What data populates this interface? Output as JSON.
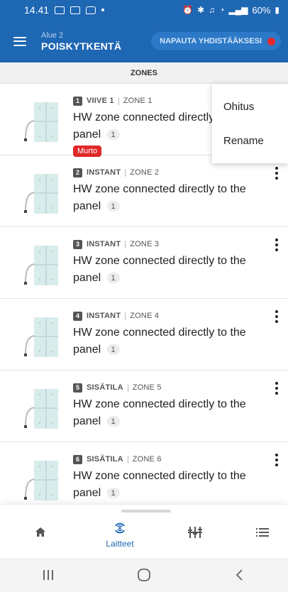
{
  "status_bar": {
    "time": "14.41",
    "battery": "60%"
  },
  "app_bar": {
    "subtitle": "Alue 2",
    "title": "POISKYTKENTÄ",
    "connect_label": "NAPAUTA YHDISTÄÄKSESI"
  },
  "section": {
    "header": "ZONES"
  },
  "popup_menu": {
    "items": [
      {
        "label": "Ohitus"
      },
      {
        "label": "Rename"
      }
    ]
  },
  "zones": [
    {
      "number": "1",
      "type": "VIIVE 1",
      "zone": "ZONE 1",
      "name": "HW zone connected directly to the panel",
      "name_shown": "HW zone connected directly",
      "name_line2": "panel",
      "count": "1",
      "badge": "Murto"
    },
    {
      "number": "2",
      "type": "INSTANT",
      "zone": "ZONE 2",
      "name": "HW zone connected directly to the",
      "name_line2": "panel",
      "count": "1"
    },
    {
      "number": "3",
      "type": "INSTANT",
      "zone": "ZONE 3",
      "name": "HW zone connected directly to the",
      "name_line2": "panel",
      "count": "1"
    },
    {
      "number": "4",
      "type": "INSTANT",
      "zone": "ZONE 4",
      "name": "HW zone connected directly to the",
      "name_line2": "panel",
      "count": "1"
    },
    {
      "number": "5",
      "type": "SISÄTILA",
      "zone": "ZONE 5",
      "name": "HW zone connected directly to the",
      "name_line2": "panel",
      "count": "1"
    },
    {
      "number": "6",
      "type": "SISÄTILA",
      "zone": "ZONE 6",
      "name": "HW zone connected directly to the",
      "name_line2": "panel",
      "count": "1"
    }
  ],
  "bottom_nav": {
    "active_label": "Laitteet",
    "items": [
      {
        "icon": "home-icon"
      },
      {
        "icon": "devices-icon"
      },
      {
        "icon": "equalizer-icon"
      },
      {
        "icon": "list-icon"
      }
    ]
  },
  "colors": {
    "primary": "#1e67b3",
    "alarm": "#e02828",
    "connect_dot": "#e62a2a"
  }
}
